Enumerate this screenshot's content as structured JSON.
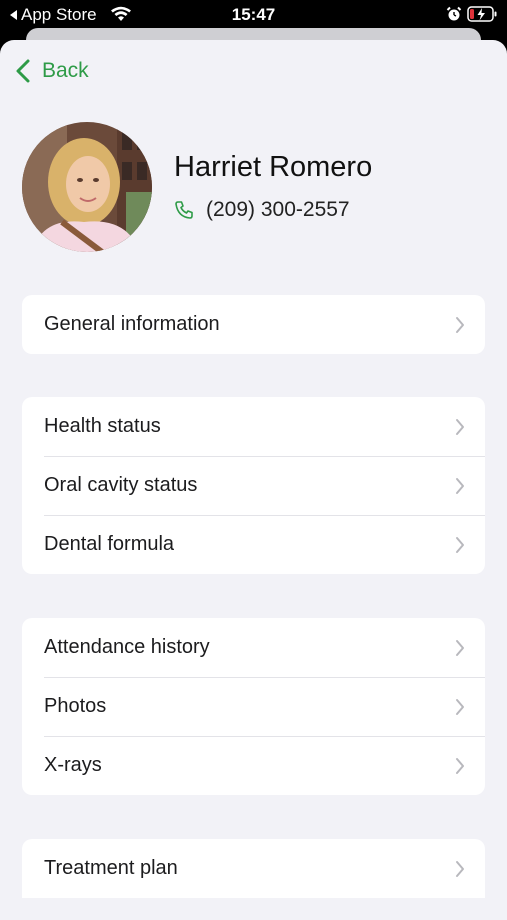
{
  "status_bar": {
    "back_app": "App Store",
    "time": "15:47"
  },
  "nav": {
    "back_label": "Back"
  },
  "patient": {
    "name": "Harriet Romero",
    "phone": "(209) 300-2557"
  },
  "groups": [
    {
      "items": [
        {
          "label": "General information"
        }
      ]
    },
    {
      "items": [
        {
          "label": "Health status"
        },
        {
          "label": "Oral cavity status"
        },
        {
          "label": "Dental formula"
        }
      ]
    },
    {
      "items": [
        {
          "label": "Attendance history"
        },
        {
          "label": "Photos"
        },
        {
          "label": "X-rays"
        }
      ]
    },
    {
      "items": [
        {
          "label": "Treatment plan"
        }
      ]
    }
  ],
  "colors": {
    "accent": "#2e9b47",
    "background": "#f2f2f7",
    "card": "#ffffff",
    "battery_low": "#e0323a"
  },
  "icons": [
    "back-chevron-icon",
    "phone-icon",
    "chevron-right-icon",
    "wifi-icon",
    "alarm-icon",
    "battery-charging-icon"
  ]
}
